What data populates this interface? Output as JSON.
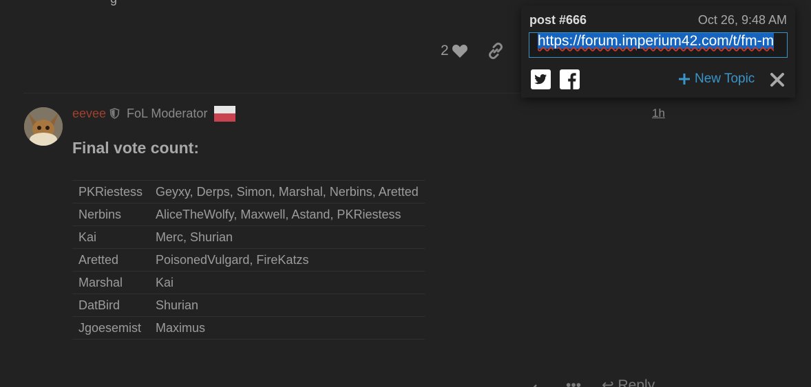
{
  "top_fragment": "g",
  "previous_post": {
    "like_count": "2"
  },
  "post": {
    "username": "eevee",
    "user_title": "FoL Moderator",
    "age": "1h",
    "heading": "Final vote count:",
    "vote_rows": [
      {
        "candidate": "PKRiestess",
        "voters": "Geyxy, Derps, Simon, Marshal, Nerbins, Aretted"
      },
      {
        "candidate": "Nerbins",
        "voters": "AliceTheWolfy, Maxwell, Astand, PKRiestess"
      },
      {
        "candidate": "Kai",
        "voters": "Merc, Shurian"
      },
      {
        "candidate": "Aretted",
        "voters": "PoisonedVulgard, FireKatzs"
      },
      {
        "candidate": "Marshal",
        "voters": "Kai"
      },
      {
        "candidate": "DatBird",
        "voters": "Shurian"
      },
      {
        "candidate": "Jgoesemist",
        "voters": "Maximus"
      }
    ],
    "bottom_reply_label": "Reply"
  },
  "share_panel": {
    "post_number": "post #666",
    "date": "Oct 26, 9:48 AM",
    "url": "https://forum.imperium42.com/t/fm-m",
    "new_topic_label": "New Topic"
  },
  "colors": {
    "background": "#222222",
    "accent": "#3a95c9",
    "username": "#a0402e"
  },
  "icons": [
    "heart-icon",
    "link-icon",
    "shield-icon",
    "twitter-icon",
    "facebook-icon",
    "plus-icon",
    "close-icon"
  ]
}
